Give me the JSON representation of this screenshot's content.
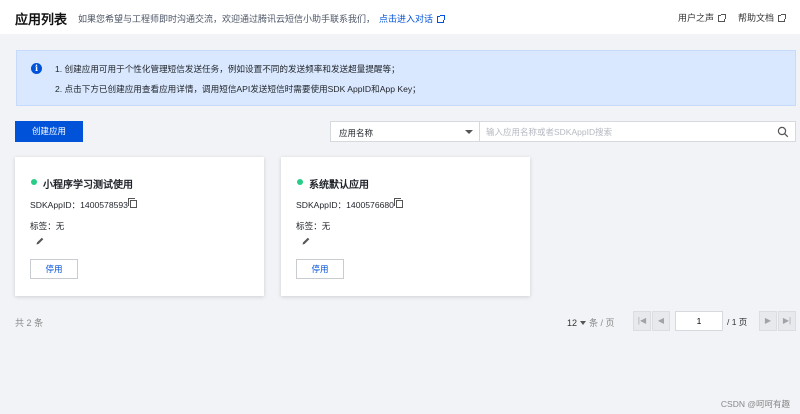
{
  "header": {
    "title": "应用列表",
    "hint": "如果您希望与工程师即时沟通交流，欢迎通过腾讯云短信小助手联系我们，",
    "hint_link": "点击进入对话",
    "user_voice": "用户之声",
    "help_docs": "帮助文档"
  },
  "notice": {
    "line1": "1. 创建应用可用于个性化管理短信发送任务，例如设置不同的发送频率和发送超量提醒等；",
    "line2": "2. 点击下方已创建应用查看应用详情，调用短信API发送短信时需要使用SDK AppID和App Key；"
  },
  "toolbar": {
    "create_label": "创建应用",
    "select_value": "应用名称",
    "search_placeholder": "输入应用名称或者SDKAppID搜索"
  },
  "apps": [
    {
      "name": "小程序学习测试使用",
      "appid_label": "SDKAppID：",
      "appid": "1400578593",
      "tag_label": "标签：",
      "tag_value": "无",
      "action": "停用",
      "status_color": "#29cc85"
    },
    {
      "name": "系统默认应用",
      "appid_label": "SDKAppID：",
      "appid": "1400576680",
      "tag_label": "标签：",
      "tag_value": "无",
      "action": "停用",
      "status_color": "#29cc85"
    }
  ],
  "pagination": {
    "total_prefix": "共",
    "total_count": "2",
    "total_suffix": "条",
    "page_size": "12",
    "page_size_unit": "条 / 页",
    "current_page": "1",
    "total_pages": "/ 1 页"
  },
  "watermark": "CSDN @呵呵有趣",
  "colors": {
    "accent": "#0052d9",
    "notice_bg": "#d9e8fe",
    "status_ok": "#29cc85"
  }
}
